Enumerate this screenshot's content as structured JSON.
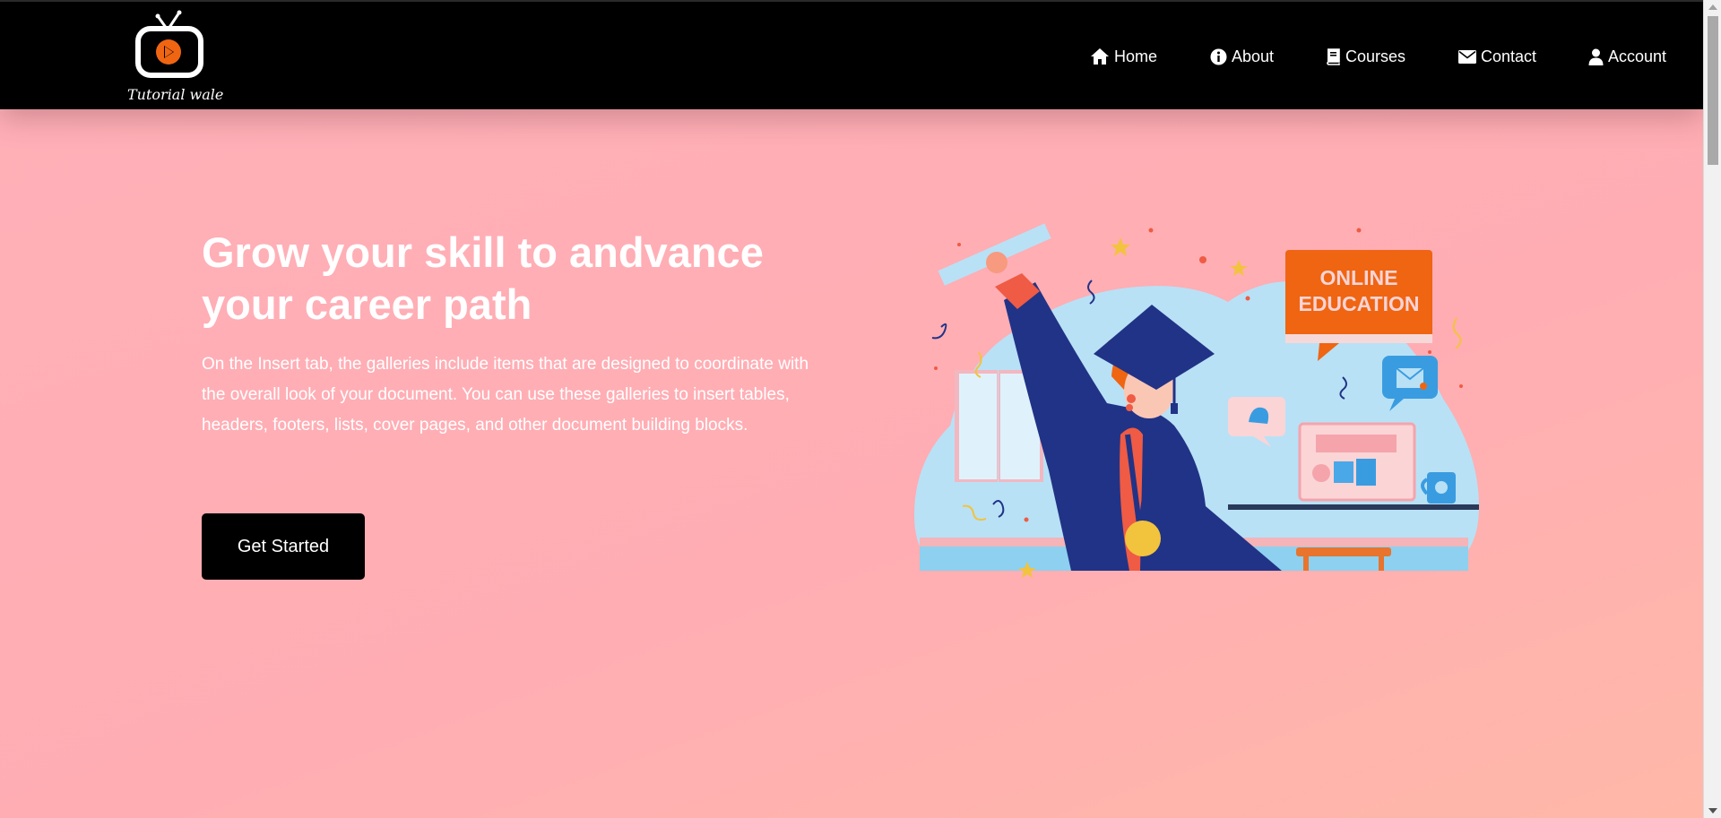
{
  "brand": {
    "name": "Tutorial wale",
    "logo_icon": "tv-play-icon"
  },
  "nav": {
    "items": [
      {
        "label": "Home",
        "icon": "home-icon"
      },
      {
        "label": "About",
        "icon": "info-icon"
      },
      {
        "label": "Courses",
        "icon": "book-icon"
      },
      {
        "label": "Contact",
        "icon": "envelope-icon"
      },
      {
        "label": "Account",
        "icon": "user-icon"
      }
    ]
  },
  "hero": {
    "title": "Grow your skill to andvance your career path",
    "description": "On the Insert tab, the galleries include items that are designed to coordinate with the overall look of your document. You can use these galleries to insert tables, headers, footers, lists, cover pages, and other document building blocks.",
    "cta_label": "Get Started"
  },
  "illustration": {
    "badge_line1": "ONLINE",
    "badge_line2": "EDUCATION"
  },
  "colors": {
    "navbar_bg": "#000000",
    "page_bg": "#ffb0b8",
    "cta_bg": "#000000",
    "accent_orange": "#ef6512",
    "accent_navy": "#213386"
  }
}
